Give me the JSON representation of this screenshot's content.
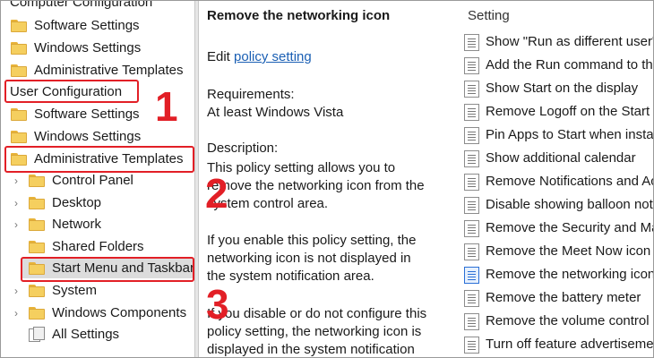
{
  "tree": {
    "computer_config_label": "Computer Configuration",
    "computer_items": [
      {
        "label": "Software Settings"
      },
      {
        "label": "Windows Settings"
      },
      {
        "label": "Administrative Templates"
      }
    ],
    "user_config_label": "User Configuration",
    "user_items": [
      {
        "label": "Software Settings"
      },
      {
        "label": "Windows Settings"
      },
      {
        "label": "Administrative Templates"
      }
    ],
    "admin_children": [
      {
        "label": "Control Panel"
      },
      {
        "label": "Desktop"
      },
      {
        "label": "Network"
      },
      {
        "label": "Shared Folders"
      },
      {
        "label": "Start Menu and Taskbar"
      },
      {
        "label": "System"
      },
      {
        "label": "Windows Components"
      },
      {
        "label": "All Settings"
      }
    ]
  },
  "description": {
    "title": "Remove the networking icon",
    "edit_prefix": "Edit ",
    "edit_link": "policy setting",
    "requirements_label": "Requirements:",
    "requirements_value": "At least Windows Vista",
    "description_label": "Description:",
    "lines": [
      "This policy setting allows you to",
      "remove the networking icon from the",
      "system control area.",
      "If you enable this policy setting, the",
      "networking icon is not displayed in",
      "the system notification area.",
      "If you disable or do not configure this",
      "policy setting, the networking icon is",
      "displayed in the system notification"
    ]
  },
  "settings": {
    "header": "Setting",
    "items": [
      {
        "label": "Show \"Run as different user\""
      },
      {
        "label": "Add the Run command to the Start Menu"
      },
      {
        "label": "Show Start on the display"
      },
      {
        "label": "Remove Logoff on the Start Menu"
      },
      {
        "label": "Pin Apps to Start when installed"
      },
      {
        "label": "Show additional calendar"
      },
      {
        "label": "Remove Notifications and Action Center"
      },
      {
        "label": "Disable showing balloon notifications"
      },
      {
        "label": "Remove the Security and Maintenance icon"
      },
      {
        "label": "Remove the Meet Now icon"
      },
      {
        "label": "Remove the networking icon"
      },
      {
        "label": "Remove the battery meter"
      },
      {
        "label": "Remove the volume control icon"
      },
      {
        "label": "Turn off feature advertisement"
      }
    ]
  },
  "annotations": {
    "step1": "1",
    "step2": "2",
    "step3": "3",
    "color": "#e21f26"
  }
}
